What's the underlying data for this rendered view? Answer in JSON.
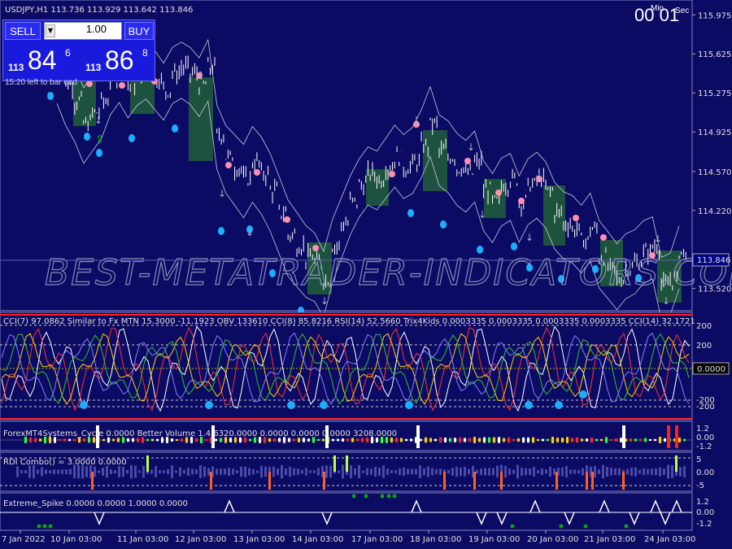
{
  "header": {
    "symbol_line": "USDJPY,H1  113.736 113.929 113.642 113.846",
    "bar_left": "15:20 left to bar end"
  },
  "trade_panel": {
    "sell_label": "SELL",
    "buy_label": "BUY",
    "lot": "1.00",
    "sell_small": "113",
    "sell_big": "84",
    "sell_sup": "6",
    "buy_small": "113",
    "buy_big": "86",
    "buy_sup": "8"
  },
  "timer": {
    "value": "00",
    "value2": "01",
    "min_label": "Min",
    "sec_label": "Sec"
  },
  "watermark": "BEST-METATRADER-INDICATORS.COM",
  "colors": {
    "background": "#0b0b63",
    "up_box": "#1f5a3a",
    "dot_cyan": "#1ab0ff",
    "dot_pink": "#ff8fb0",
    "current_price": "#000080"
  },
  "chart_data": [
    {
      "type": "candlestick",
      "title": "USDJPY,H1",
      "current_price": "113.846",
      "y_ticks": [
        "115.975",
        "115.625",
        "115.275",
        "114.925",
        "114.570",
        "114.220",
        "113.520"
      ],
      "ylim": [
        113.35,
        116.05
      ],
      "x_ticks": [
        "7 Jan 2022",
        "10 Jan 03:00",
        "11 Jan 03:00",
        "12 Jan 03:00",
        "13 Jan 03:00",
        "14 Jan 03:00",
        "17 Jan 03:00",
        "18 Jan 03:00",
        "19 Jan 03:00",
        "20 Jan 03:00",
        "21 Jan 03:00",
        "24 Jan 03:00"
      ],
      "close_path": [
        115.55,
        115.35,
        115.2,
        115.0,
        115.1,
        115.2,
        115.4,
        115.5,
        115.35,
        115.45,
        115.5,
        115.4,
        115.3,
        115.45,
        115.5,
        115.45,
        115.35,
        115.5,
        114.9,
        114.7,
        114.6,
        114.5,
        114.65,
        114.55,
        114.4,
        114.2,
        114.0,
        113.9,
        113.8,
        113.75,
        113.6,
        113.9,
        114.1,
        114.3,
        114.45,
        114.55,
        114.5,
        114.6,
        114.7,
        114.6,
        114.65,
        114.8,
        115.0,
        114.75,
        114.7,
        114.6,
        114.55,
        114.65,
        114.4,
        114.3,
        114.45,
        114.5,
        114.3,
        114.45,
        114.5,
        114.4,
        114.2,
        114.1,
        114.05,
        113.95,
        114.05,
        113.8,
        113.7,
        113.6,
        113.7,
        113.75,
        113.85,
        113.9,
        113.55,
        113.6,
        113.85
      ]
    },
    {
      "type": "line",
      "title": "CCI(7) 97.0862  Similar to Fx MTN  15.3000 -11.1923  OBV 133610  CCI(8) 85.8216  RSI(14) 52.5660  Trix4Kids 0.0003335 0.0003335 0.0003335 0.0003335  CCI(14) 32.1721",
      "y_ticks": [
        "200",
        "200",
        "-200",
        "-200"
      ],
      "value_box": "0.0000"
    },
    {
      "type": "bar",
      "title": "ForexMT4Systems_Cycle 0.0000  Better Volume 1.4 6320.0000 0.0000 0.0000 0.0000 3208.0000",
      "y_ticks": [
        "1.2",
        "0.00",
        "-1.2"
      ]
    },
    {
      "type": "bar",
      "title": "RDI Combo() = 3.0000 0.0000",
      "y_ticks": [
        "5",
        "0.00",
        "-5"
      ]
    },
    {
      "type": "line",
      "title": "Extreme_Spike 0.0000 0.0000 1.0000 0.0000",
      "y_ticks": [
        "1.2",
        "0.00",
        "-1.2"
      ]
    }
  ]
}
